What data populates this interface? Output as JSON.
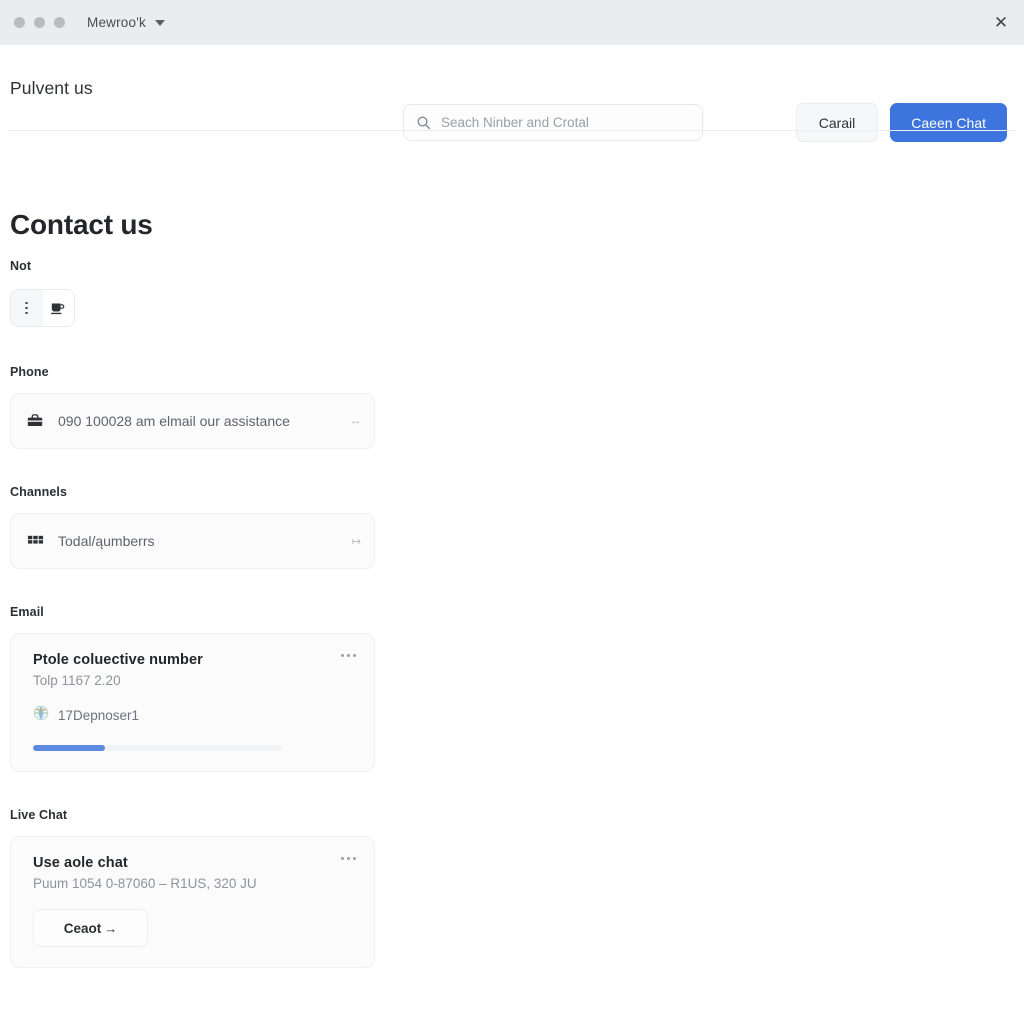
{
  "window": {
    "title": "Mewroo'k",
    "dropdown_caret": "chevron-down",
    "close_label": "✕"
  },
  "header": {
    "brand": "Pulvent us",
    "search": {
      "placeholder": "Seach Ninber and Crotal",
      "value": ""
    },
    "secondary_button": "Carail",
    "primary_button": "Caeen Chat",
    "primary_color": "#3d74dd"
  },
  "page": {
    "title": "Contact us"
  },
  "sections": {
    "not": {
      "label": "Not",
      "segmented": {
        "left_icon": "more-vertical-icon",
        "right_icon": "cup-icon",
        "active": "right"
      }
    },
    "phone": {
      "label": "Phone",
      "row": {
        "icon": "briefcase-icon",
        "text": "090 100028 am elmail our assistance",
        "trailing": "↔"
      }
    },
    "channels": {
      "label": "Channels",
      "row": {
        "icon": "grid-icon",
        "text": "Todal/ąumberrs",
        "trailing": "↦"
      }
    },
    "email": {
      "label": "Email",
      "card": {
        "title": "Ptole coluective number",
        "subtitle": "Tolp 1167 2.20",
        "meta_icon": "globe-icon",
        "meta_text": "17Depnoser1",
        "menu_icon": "more-horizontal-icon",
        "progress_percent": 29,
        "progress_color": "#5b8ae0"
      }
    },
    "live_chat": {
      "label": "Live Chat",
      "card": {
        "title": "Use aole chat",
        "subtitle": "Puum 1054 0-87060 – R1US, 320 JU",
        "menu_icon": "more-horizontal-icon",
        "button_label": "Ceaot",
        "button_arrow": "→"
      }
    }
  }
}
